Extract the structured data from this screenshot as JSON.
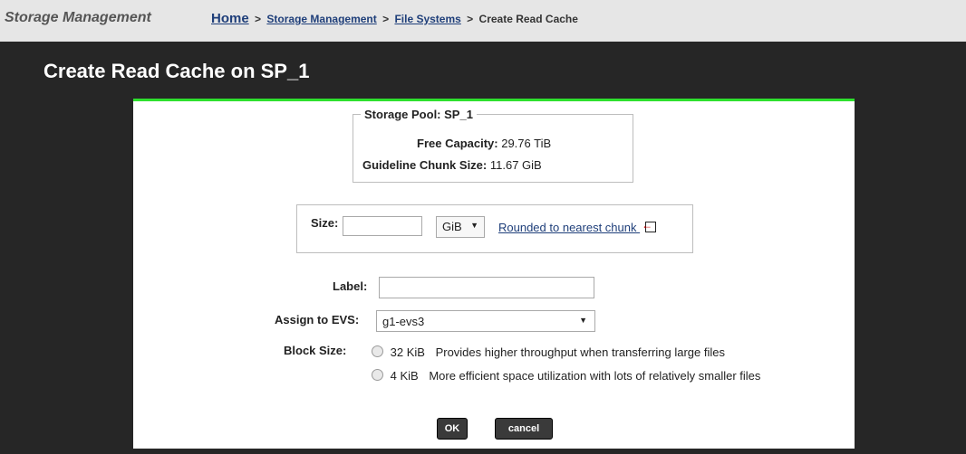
{
  "header": {
    "app_title": "Storage Management",
    "breadcrumb": {
      "home": "Home",
      "sep": ">",
      "storage_management": "Storage Management",
      "file_systems": "File Systems",
      "current": "Create Read Cache"
    }
  },
  "page_title": "Create Read Cache on SP_1",
  "storage_pool": {
    "legend": "Storage Pool: SP_1",
    "free_capacity_label": "Free Capacity:",
    "free_capacity_value": "29.76 TiB",
    "chunk_size_label": "Guideline Chunk Size:",
    "chunk_size_value": "11.67 GiB"
  },
  "size": {
    "label": "Size:",
    "value": "",
    "unit": "GiB",
    "unit_arrow": "▼",
    "rounded_link": "Rounded to nearest chunk"
  },
  "label_field": {
    "label": "Label:",
    "value": ""
  },
  "evs": {
    "label": "Assign to EVS:",
    "value": "g1-evs3",
    "arrow": "▼"
  },
  "block_size": {
    "label": "Block Size:",
    "options": [
      {
        "size": "32 KiB",
        "description": "Provides higher throughput when transferring large files"
      },
      {
        "size": "4 KiB",
        "description": "More efficient space utilization with lots of relatively smaller files"
      }
    ]
  },
  "buttons": {
    "ok": "OK",
    "cancel": "cancel"
  },
  "colors": {
    "panel_accent": "#2ee02e",
    "link": "#1f3f7a",
    "background": "#262626"
  }
}
